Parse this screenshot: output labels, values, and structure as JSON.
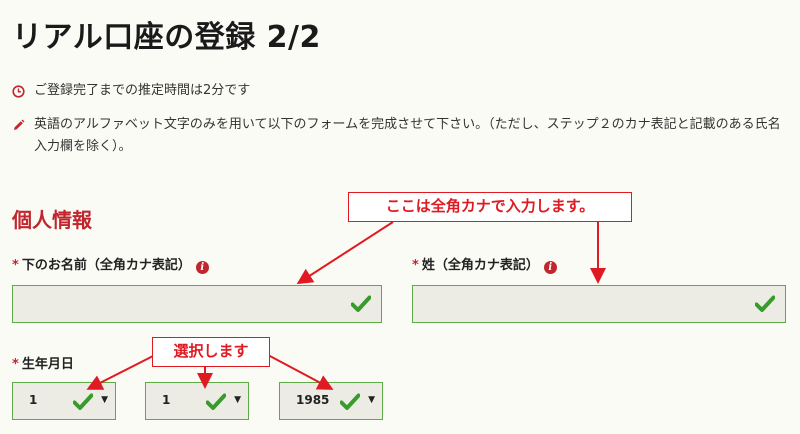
{
  "title": "リアル口座の登録 2/2",
  "info": {
    "time_text": "ご登録完了までの推定時間は2分です",
    "instruction_text": "英語のアルファベット文字のみを用いて以下のフォームを完成させて下さい。（ただし、ステップ２のカナ表記と記載のある氏名入力欄を除く）。"
  },
  "section": {
    "title": "個人情報"
  },
  "fields": {
    "first_name_label": "下のお名前（全角カナ表記）",
    "last_name_label": "姓（全角カナ表記）",
    "first_name_value": "",
    "last_name_value": "",
    "birthdate_label": "生年月日",
    "required_mark": "*"
  },
  "birthdate": {
    "day": "1",
    "month": "1",
    "year": "1985"
  },
  "annotations": {
    "kana_note": "ここは全角カナで入力します。",
    "select_note": "選択します"
  },
  "colors": {
    "accent_red": "#c0262d",
    "callout_red": "#e01a22",
    "valid_green": "#3a9b2d",
    "field_border": "#5eaa47"
  },
  "icons": {
    "clock": "clock-icon",
    "pencil": "pencil-icon",
    "info": "info-icon",
    "check": "check-icon",
    "caret": "caret-down-icon"
  }
}
